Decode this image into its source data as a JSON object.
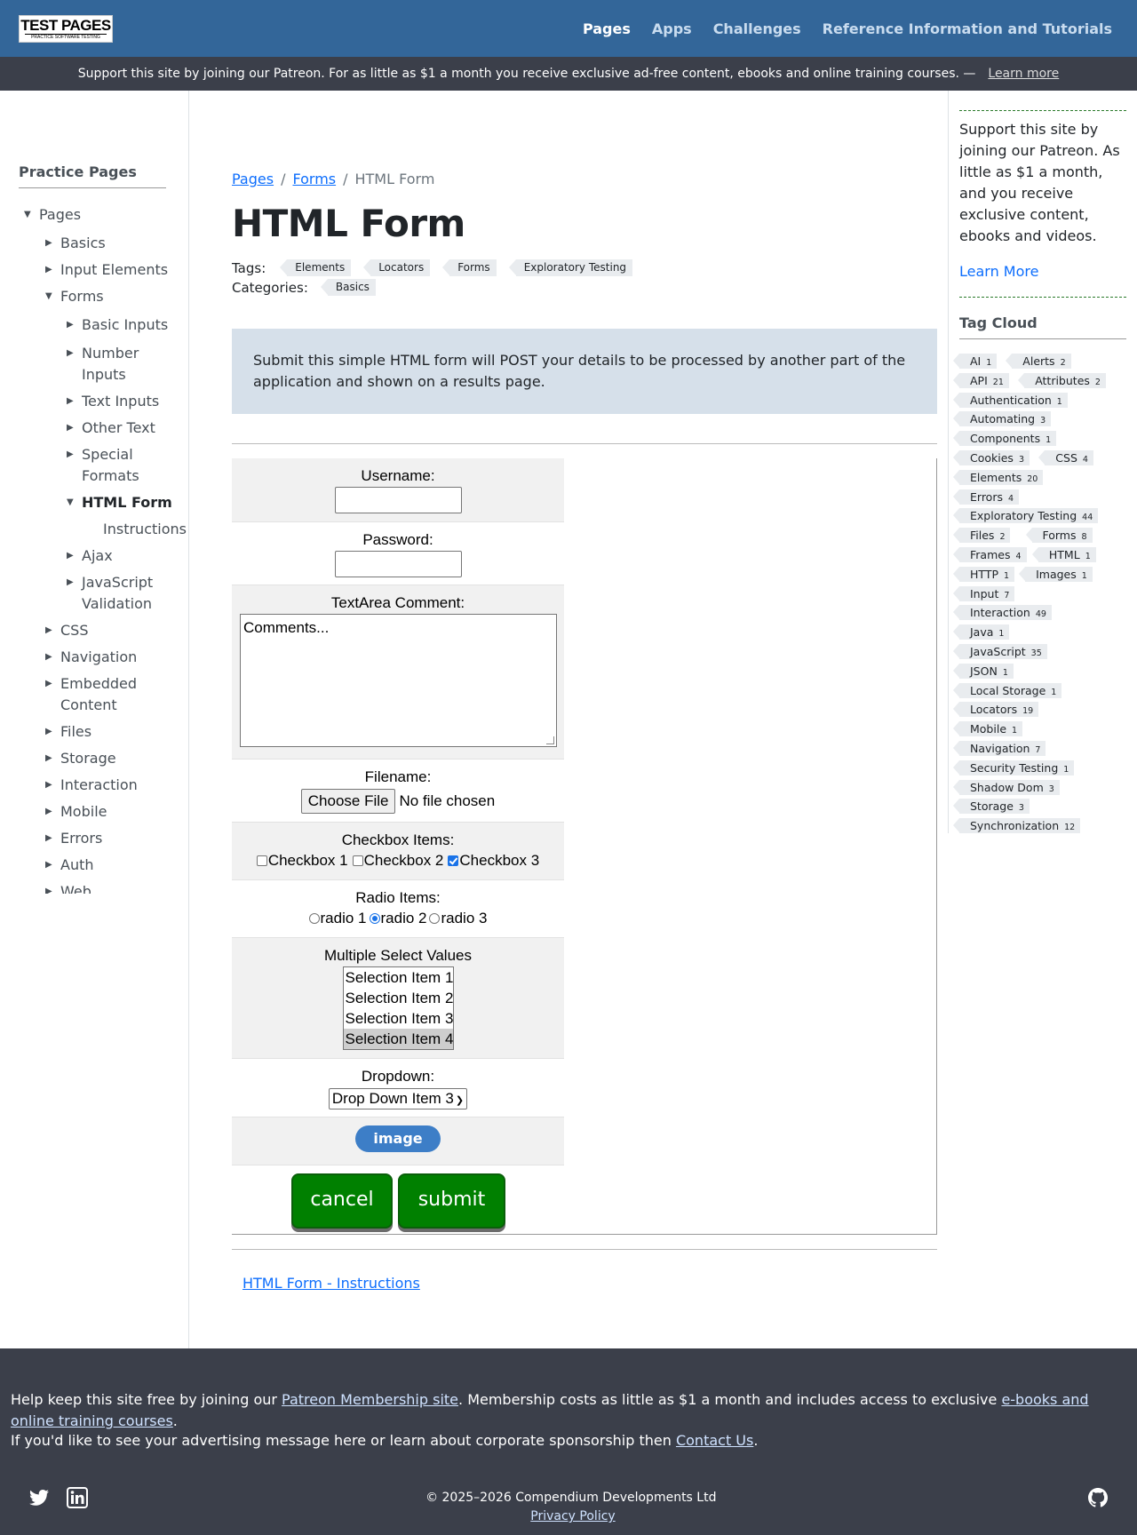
{
  "header": {
    "logo_line1": "TEST PAGES",
    "logo_line2": "PRACTICE SOFTWARE TESTING",
    "nav": [
      "Pages",
      "Apps",
      "Challenges",
      "Reference Information and Tutorials"
    ],
    "active_nav": "Pages"
  },
  "promo": {
    "text": "Support this site by joining our Patreon. For as little as $1 a month you receive exclusive ad-free content, ebooks and online training courses. —",
    "link": "Learn more"
  },
  "leftbar": {
    "title": "Practice Pages",
    "tree": [
      {
        "label": "Pages",
        "level": 0,
        "expanded": true
      },
      {
        "label": "Basics",
        "level": 1,
        "expanded": false
      },
      {
        "label": "Input Elements",
        "level": 1,
        "expanded": false
      },
      {
        "label": "Forms",
        "level": 1,
        "expanded": true
      },
      {
        "label": "Basic Inputs",
        "level": 2,
        "expanded": false
      },
      {
        "label": "Number Inputs",
        "level": 2,
        "expanded": false
      },
      {
        "label": "Text Inputs",
        "level": 2,
        "expanded": false
      },
      {
        "label": "Other Text",
        "level": 2,
        "expanded": false
      },
      {
        "label": "Special Formats",
        "level": 2,
        "expanded": false
      },
      {
        "label": "HTML Form",
        "level": 2,
        "expanded": true,
        "current": true
      },
      {
        "label": "Instructions",
        "level": 3
      },
      {
        "label": "Ajax",
        "level": 2,
        "expanded": false
      },
      {
        "label": "JavaScript Validation",
        "level": 2,
        "expanded": false
      },
      {
        "label": "CSS",
        "level": 1,
        "expanded": false
      },
      {
        "label": "Navigation",
        "level": 1,
        "expanded": false
      },
      {
        "label": "Embedded Content",
        "level": 1,
        "expanded": false
      },
      {
        "label": "Files",
        "level": 1,
        "expanded": false
      },
      {
        "label": "Storage",
        "level": 1,
        "expanded": false
      },
      {
        "label": "Interaction",
        "level": 1,
        "expanded": false
      },
      {
        "label": "Mobile",
        "level": 1,
        "expanded": false
      },
      {
        "label": "Errors",
        "level": 1,
        "expanded": false
      },
      {
        "label": "Auth",
        "level": 1,
        "expanded": false
      },
      {
        "label": "Web",
        "level": 1,
        "expanded": false
      }
    ]
  },
  "breadcrumb": {
    "items": [
      "Pages",
      "Forms",
      "HTML Form"
    ]
  },
  "page": {
    "title": "HTML Form",
    "tags_label": "Tags:",
    "tags": [
      "Elements",
      "Locators",
      "Forms",
      "Exploratory Testing"
    ],
    "categories_label": "Categories:",
    "categories": [
      "Basics"
    ],
    "callout": "Submit this simple HTML form will POST your details to be processed by another part of the application and shown on a results page."
  },
  "form": {
    "username_label": "Username:",
    "username_value": "",
    "password_label": "Password:",
    "password_value": "",
    "textarea_label": "TextArea Comment:",
    "textarea_value": "Comments...",
    "filename_label": "Filename:",
    "file_button": "Choose File",
    "file_status": "No file chosen",
    "checkbox_label": "Checkbox Items:",
    "checkboxes": [
      {
        "label": "Checkbox 1",
        "checked": false
      },
      {
        "label": "Checkbox 2",
        "checked": false
      },
      {
        "label": "Checkbox 3",
        "checked": true
      }
    ],
    "radio_label": "Radio Items:",
    "radios": [
      {
        "label": "radio 1",
        "checked": false
      },
      {
        "label": "radio 2",
        "checked": true
      },
      {
        "label": "radio 3",
        "checked": false
      }
    ],
    "multiselect_label": "Multiple Select Values",
    "multiselect_options": [
      {
        "label": "Selection Item 1",
        "selected": false
      },
      {
        "label": "Selection Item 2",
        "selected": false
      },
      {
        "label": "Selection Item 3",
        "selected": false
      },
      {
        "label": "Selection Item 4",
        "selected": true
      }
    ],
    "dropdown_label": "Dropdown:",
    "dropdown_value": "Drop Down Item 3",
    "image_button": "image",
    "cancel_button": "cancel",
    "submit_button": "submit"
  },
  "instructions_link": "HTML Form - Instructions",
  "rightbar": {
    "support_text": "Support this site by joining our Patreon. As little as $1 a month, and you receive exclusive content, ebooks and videos.",
    "learn_more": "Learn More",
    "cloud_title": "Tag Cloud",
    "cloud": [
      {
        "name": "AI",
        "count": "1"
      },
      {
        "name": "Alerts",
        "count": "2"
      },
      {
        "name": "API",
        "count": "21"
      },
      {
        "name": "Attributes",
        "count": "2"
      },
      {
        "name": "Authentication",
        "count": "1"
      },
      {
        "name": "Automating",
        "count": "3"
      },
      {
        "name": "Components",
        "count": "1"
      },
      {
        "name": "Cookies",
        "count": "3"
      },
      {
        "name": "CSS",
        "count": "4"
      },
      {
        "name": "Elements",
        "count": "20"
      },
      {
        "name": "Errors",
        "count": "4"
      },
      {
        "name": "Exploratory Testing",
        "count": "44"
      },
      {
        "name": "Files",
        "count": "2"
      },
      {
        "name": "Forms",
        "count": "8"
      },
      {
        "name": "Frames",
        "count": "4"
      },
      {
        "name": "HTML",
        "count": "1"
      },
      {
        "name": "HTTP",
        "count": "1"
      },
      {
        "name": "Images",
        "count": "1"
      },
      {
        "name": "Input",
        "count": "7"
      },
      {
        "name": "Interaction",
        "count": "49"
      },
      {
        "name": "Java",
        "count": "1"
      },
      {
        "name": "JavaScript",
        "count": "35"
      },
      {
        "name": "JSON",
        "count": "1"
      },
      {
        "name": "Local Storage",
        "count": "1"
      },
      {
        "name": "Locators",
        "count": "19"
      },
      {
        "name": "Mobile",
        "count": "1"
      },
      {
        "name": "Navigation",
        "count": "7"
      },
      {
        "name": "Security Testing",
        "count": "1"
      },
      {
        "name": "Shadow Dom",
        "count": "3"
      },
      {
        "name": "Storage",
        "count": "3"
      },
      {
        "name": "Synchronization",
        "count": "12"
      }
    ]
  },
  "footer": {
    "p1_a": "Help keep this site free by joining our ",
    "p1_link1": "Patreon Membership site",
    "p1_b": ". Membership costs as little as $1 a month and includes access to exclusive ",
    "p1_link2": "e-books and online training courses",
    "p1_c": ".",
    "p2_a": "If you'd like to see your advertising message here or learn about corporate sponsorship then ",
    "p2_link": "Contact Us",
    "p2_b": ".",
    "copyright": "© 2025–2026  Compendium Developments Ltd",
    "privacy": "Privacy Policy",
    "icons": [
      "twitter-icon",
      "linkedin-icon",
      "github-icon"
    ]
  }
}
